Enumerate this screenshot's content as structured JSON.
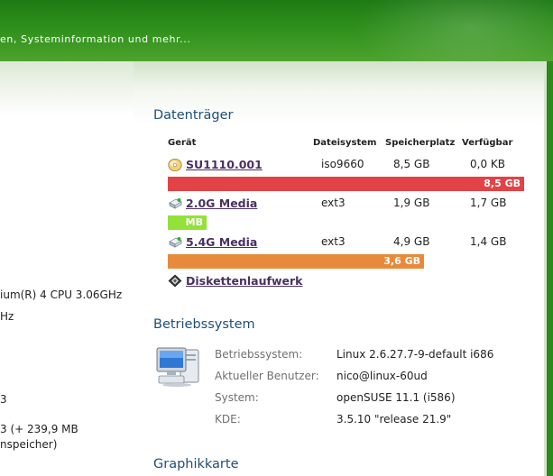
{
  "header": {
    "tagline": "en, Systeminformation und mehr..."
  },
  "left_column": {
    "lines": [
      "ium(R) 4 CPU 3.06GHz",
      "Hz",
      "3",
      "3 (+ 239,9 MB",
      "nspeicher)"
    ]
  },
  "drives": {
    "title": "Datenträger",
    "columns": [
      "Gerät",
      "Dateisystem",
      "Speicherplatz",
      "Verfügbar"
    ],
    "items": [
      {
        "name": "SU1110.001",
        "icon": "cd-icon",
        "filesystem": "iso9660",
        "size": "8,5 GB",
        "available": "0,0 KB",
        "bar_label": "8,5 GB",
        "bar_color": "#e34246",
        "used_fraction": 1.0
      },
      {
        "name": "2.0G Media",
        "icon": "usb-drive-icon",
        "filesystem": "ext3",
        "size": "1,9 GB",
        "available": "1,7 GB",
        "bar_label": "MB",
        "bar_color": "#93e23a",
        "used_fraction": 0.11
      },
      {
        "name": "5.4G Media",
        "icon": "usb-drive-icon",
        "filesystem": "ext3",
        "size": "4,9 GB",
        "available": "1,4 GB",
        "bar_label": "3,6 GB",
        "bar_color": "#e88a3c",
        "used_fraction": 0.72
      },
      {
        "name": "Diskettenlaufwerk",
        "icon": "floppy-icon"
      }
    ]
  },
  "os": {
    "title": "Betriebssystem",
    "rows": [
      {
        "label": "Betriebssystem:",
        "value": "Linux 2.6.27.7-9-default i686"
      },
      {
        "label": "Aktueller Benutzer:",
        "value": "nico@linux-60ud"
      },
      {
        "label": "System:",
        "value": "openSUSE 11.1 (i586)"
      },
      {
        "label": "KDE:",
        "value": "3.5.10 \"release 21.9\""
      }
    ]
  },
  "graphics": {
    "title": "Graphikkarte"
  }
}
